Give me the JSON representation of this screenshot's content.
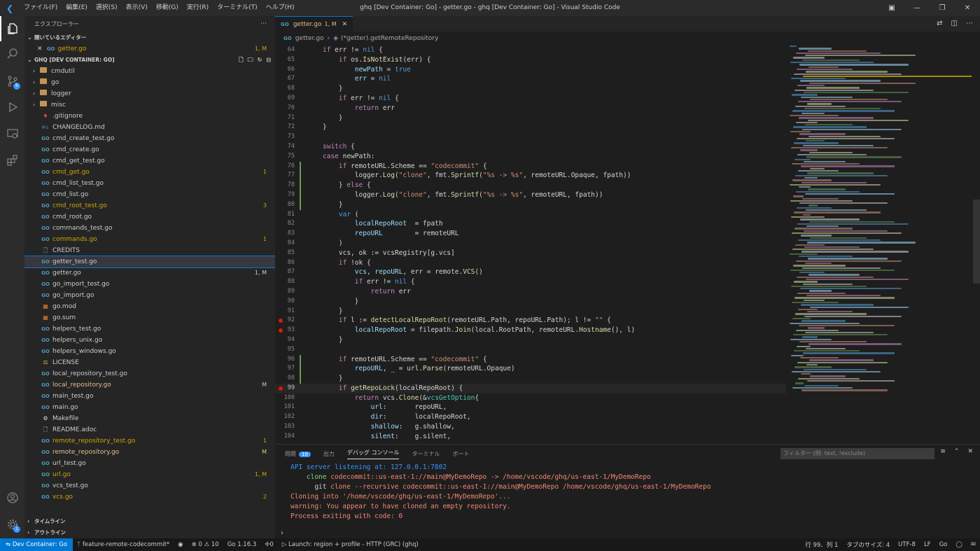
{
  "title_bar": {
    "window_title": "ghq [Dev Container: Go] - getter.go - ghq [Dev Container: Go] - Visual Studio Code",
    "menus": [
      "ファイル(F)",
      "編集(E)",
      "選択(S)",
      "表示(V)",
      "移動(G)",
      "実行(R)",
      "ターミナル(T)",
      "ヘルプ(H)"
    ]
  },
  "activity_bar": {
    "scm_badge": "6",
    "settings_badge": "1"
  },
  "sidebar": {
    "title": "エクスプローラー",
    "open_editors_header": "開いているエディター",
    "open_editor": {
      "name": "getter.go",
      "status": "1, M"
    },
    "workspace_header": "GHQ [DEV CONTAINER: GO]",
    "files": [
      {
        "name": "cmdutil",
        "kind": "folder",
        "status": "",
        "color": "normal"
      },
      {
        "name": "go",
        "kind": "folder",
        "status": "",
        "color": "normal"
      },
      {
        "name": "logger",
        "kind": "folder",
        "status": "",
        "color": "normal"
      },
      {
        "name": "misc",
        "kind": "folder",
        "status": "",
        "color": "normal"
      },
      {
        "name": ".gitignore",
        "kind": "git",
        "status": "",
        "color": "normal"
      },
      {
        "name": "CHANGELOG.md",
        "kind": "md",
        "status": "",
        "color": "normal"
      },
      {
        "name": "cmd_create_test.go",
        "kind": "go",
        "status": "",
        "color": "normal"
      },
      {
        "name": "cmd_create.go",
        "kind": "go",
        "status": "",
        "color": "normal"
      },
      {
        "name": "cmd_get_test.go",
        "kind": "go",
        "status": "",
        "color": "normal"
      },
      {
        "name": "cmd_get.go",
        "kind": "go",
        "status": "1",
        "color": "warn"
      },
      {
        "name": "cmd_list_test.go",
        "kind": "go",
        "status": "",
        "color": "normal"
      },
      {
        "name": "cmd_list.go",
        "kind": "go",
        "status": "",
        "color": "normal"
      },
      {
        "name": "cmd_root_test.go",
        "kind": "go",
        "status": "3",
        "color": "warn"
      },
      {
        "name": "cmd_root.go",
        "kind": "go",
        "status": "",
        "color": "normal"
      },
      {
        "name": "commands_test.go",
        "kind": "go",
        "status": "",
        "color": "normal"
      },
      {
        "name": "commands.go",
        "kind": "go",
        "status": "1",
        "color": "warn"
      },
      {
        "name": "CREDITS",
        "kind": "file",
        "status": "",
        "color": "normal"
      },
      {
        "name": "getter_test.go",
        "kind": "go",
        "status": "",
        "color": "normal"
      },
      {
        "name": "getter.go",
        "kind": "go",
        "status": "1, M",
        "color": "normal"
      },
      {
        "name": "go_import_test.go",
        "kind": "go",
        "status": "",
        "color": "normal"
      },
      {
        "name": "go_import.go",
        "kind": "go",
        "status": "",
        "color": "normal"
      },
      {
        "name": "go.mod",
        "kind": "mod",
        "status": "",
        "color": "normal"
      },
      {
        "name": "go.sum",
        "kind": "mod",
        "status": "",
        "color": "normal"
      },
      {
        "name": "helpers_test.go",
        "kind": "go",
        "status": "",
        "color": "normal"
      },
      {
        "name": "helpers_unix.go",
        "kind": "go",
        "status": "",
        "color": "normal"
      },
      {
        "name": "helpers_windows.go",
        "kind": "go",
        "status": "",
        "color": "normal"
      },
      {
        "name": "LICENSE",
        "kind": "license",
        "status": "",
        "color": "normal"
      },
      {
        "name": "local_repository_test.go",
        "kind": "go",
        "status": "",
        "color": "normal"
      },
      {
        "name": "local_repository.go",
        "kind": "go",
        "status": "M",
        "color": "mod"
      },
      {
        "name": "main_test.go",
        "kind": "go",
        "status": "",
        "color": "normal"
      },
      {
        "name": "main.go",
        "kind": "go",
        "status": "",
        "color": "normal"
      },
      {
        "name": "Makefile",
        "kind": "make",
        "status": "",
        "color": "normal"
      },
      {
        "name": "README.adoc",
        "kind": "file",
        "status": "",
        "color": "normal"
      },
      {
        "name": "remote_repository_test.go",
        "kind": "go",
        "status": "1",
        "color": "warn"
      },
      {
        "name": "remote_repository.go",
        "kind": "go",
        "status": "M",
        "color": "mod"
      },
      {
        "name": "url_test.go",
        "kind": "go",
        "status": "",
        "color": "normal"
      },
      {
        "name": "url.go",
        "kind": "go",
        "status": "1, M",
        "color": "warn"
      },
      {
        "name": "vcs_test.go",
        "kind": "go",
        "status": "",
        "color": "normal"
      },
      {
        "name": "vcs.go",
        "kind": "go",
        "status": "2",
        "color": "warn"
      }
    ],
    "timeline_header": "タイムライン",
    "outline_header": "アウトライン"
  },
  "editor": {
    "tab": {
      "name": "getter.go",
      "status": "1, M"
    },
    "breadcrumb": {
      "file": "getter.go",
      "symbol": "(*getter).getRemoteRepository"
    },
    "lines": [
      {
        "n": "64",
        "bp": false,
        "html": "<span class='k'>if</span> err != <span class='kw'>nil</span> {"
      },
      {
        "n": "65",
        "bp": false,
        "html": "    <span class='k'>if</span> os.<span class='f'>IsNotExist</span>(err) {"
      },
      {
        "n": "66",
        "bp": false,
        "html": "        <span class='v'>newPath</span> = <span class='kw'>true</span>"
      },
      {
        "n": "67",
        "bp": false,
        "html": "        <span class='v'>err</span> = <span class='kw'>nil</span>"
      },
      {
        "n": "68",
        "bp": false,
        "html": "    }"
      },
      {
        "n": "69",
        "bp": false,
        "html": "    <span class='k'>if</span> err != <span class='kw'>nil</span> {"
      },
      {
        "n": "70",
        "bp": false,
        "html": "        <span class='k'>return</span> err"
      },
      {
        "n": "71",
        "bp": false,
        "html": "    }"
      },
      {
        "n": "72",
        "bp": false,
        "html": "}"
      },
      {
        "n": "73",
        "bp": false,
        "html": ""
      },
      {
        "n": "74",
        "bp": false,
        "html": "<span class='k'>switch</span> {"
      },
      {
        "n": "75",
        "bp": false,
        "html": "<span class='k'>case</span> newPath:"
      },
      {
        "n": "76",
        "bp": false,
        "html": "    <span class='k'>if</span> remoteURL.Scheme == <span class='s'>\"codecommit\"</span> {"
      },
      {
        "n": "77",
        "bp": false,
        "html": "        logger.<span class='f'>Log</span>(<span class='s'>\"clone\"</span>, fmt.<span class='f'>Sprintf</span>(<span class='s'>\"%s -> %s\"</span>, remoteURL.Opaque, fpath))"
      },
      {
        "n": "78",
        "bp": false,
        "html": "    } <span class='k'>else</span> {"
      },
      {
        "n": "79",
        "bp": false,
        "html": "        logger.<span class='f'>Log</span>(<span class='s'>\"clone\"</span>, fmt.<span class='f'>Sprintf</span>(<span class='s'>\"%s -> %s\"</span>, remoteURL, fpath))"
      },
      {
        "n": "80",
        "bp": false,
        "html": "    }"
      },
      {
        "n": "81",
        "bp": false,
        "html": "    <span class='kw'>var</span> ("
      },
      {
        "n": "82",
        "bp": false,
        "html": "        <span class='v'>localRepoRoot</span>  = fpath"
      },
      {
        "n": "83",
        "bp": false,
        "html": "        <span class='v'>repoURL</span>        = remoteURL"
      },
      {
        "n": "84",
        "bp": false,
        "html": "    )"
      },
      {
        "n": "85",
        "bp": false,
        "html": "    vcs, ok := vcsRegistry[g.vcs]"
      },
      {
        "n": "86",
        "bp": false,
        "html": "    <span class='k'>if</span> !ok {"
      },
      {
        "n": "87",
        "bp": false,
        "html": "        <span class='v'>vcs</span>, <span class='v'>repoURL</span>, err = remote.<span class='f'>VCS</span>()"
      },
      {
        "n": "88",
        "bp": false,
        "html": "        <span class='k'>if</span> err != <span class='kw'>nil</span> {"
      },
      {
        "n": "89",
        "bp": false,
        "html": "            <span class='k'>return</span> err"
      },
      {
        "n": "90",
        "bp": false,
        "html": "        }"
      },
      {
        "n": "91",
        "bp": false,
        "html": "    }"
      },
      {
        "n": "92",
        "bp": true,
        "html": "    <span class='k'>if</span> l := <span class='f'>detectLocalRepoRoot</span>(remoteURL.Path, repoURL.Path); l != <span class='s'>\"\"</span> {"
      },
      {
        "n": "93",
        "bp": true,
        "html": "        <span class='v'>localRepoRoot</span> = filepath.<span class='f'>Join</span>(local.RootPath, remoteURL.<span class='f'>Hostname</span>(), l)"
      },
      {
        "n": "94",
        "bp": false,
        "html": "    }"
      },
      {
        "n": "95",
        "bp": false,
        "html": ""
      },
      {
        "n": "96",
        "bp": false,
        "html": "    <span class='k'>if</span> remoteURL.Scheme == <span class='s'>\"codecommit\"</span> {"
      },
      {
        "n": "97",
        "bp": false,
        "html": "        <span class='v'>repoURL</span>, _ = url.<span class='f'>Parse</span>(remoteURL.Opaque)"
      },
      {
        "n": "98",
        "bp": false,
        "html": "    }"
      },
      {
        "n": "99",
        "bp": true,
        "html": "    <span class='k'>if</span> <span class='f'>getRepoLock</span>(localRepoRoot) {"
      },
      {
        "n": "100",
        "bp": false,
        "html": "        <span class='k'>return</span> vcs.<span class='f'>Clone</span>(&amp;<span class='t'>vcsGetOption</span>{"
      },
      {
        "n": "101",
        "bp": false,
        "html": "            <span class='v'>url</span>:       repoURL,"
      },
      {
        "n": "102",
        "bp": false,
        "html": "            <span class='v'>dir</span>:       localRepoRoot,"
      },
      {
        "n": "103",
        "bp": false,
        "html": "            <span class='v'>shallow</span>:   g.shallow,"
      },
      {
        "n": "104",
        "bp": false,
        "html": "            <span class='v'>silent</span>:    g.silent,"
      }
    ]
  },
  "panel": {
    "tabs": [
      "問題",
      "出力",
      "デバッグ コンソール",
      "ターミナル",
      "ポート"
    ],
    "problems_count": "10",
    "filter_placeholder": "フィルター (例: text, !exclude)",
    "console_lines": [
      {
        "text": "API server listening at: 127.0.0.1:7802",
        "color": "#3794ff"
      },
      {
        "text": "    clone codecommit::us-east-1://main@MyDemoRepo -> /home/vscode/ghq/us-east-1/MyDemoRepo",
        "color": "#f48771",
        "prefix": "    clone",
        "prefix_color": "#89d185"
      },
      {
        "text": "      git clone --recursive codecommit::us-east-1://main@MyDemoRepo /home/vscode/ghq/us-east-1/MyDemoRepo",
        "color": "#f48771",
        "prefix": "      git",
        "prefix_color": "#cccccc"
      },
      {
        "text": "Cloning into '/home/vscode/ghq/us-east-1/MyDemoRepo'...",
        "color": "#f48771"
      },
      {
        "text": "warning: You appear to have cloned an empty repository.",
        "color": "#f48771"
      },
      {
        "text": "Process exiting with code: 0",
        "color": "#f48771"
      }
    ]
  },
  "status_bar": {
    "remote": "Dev Container: Go",
    "branch": "feature-remote-codecommit*",
    "errors": "0",
    "warnings": "10",
    "go_version": "Go 1.16.3",
    "ports": "0",
    "launch": "Launch: region + profile - HTTP (GRC) (ghq)",
    "cursor": "行 99、列 1",
    "tab_size": "タブのサイズ: 4",
    "encoding": "UTF-8",
    "eol": "LF",
    "language": "Go"
  },
  "colors": {
    "accent": "#0078d4",
    "modified": "#e2c08d",
    "warning": "#cca700",
    "breakpoint": "#e51400"
  }
}
